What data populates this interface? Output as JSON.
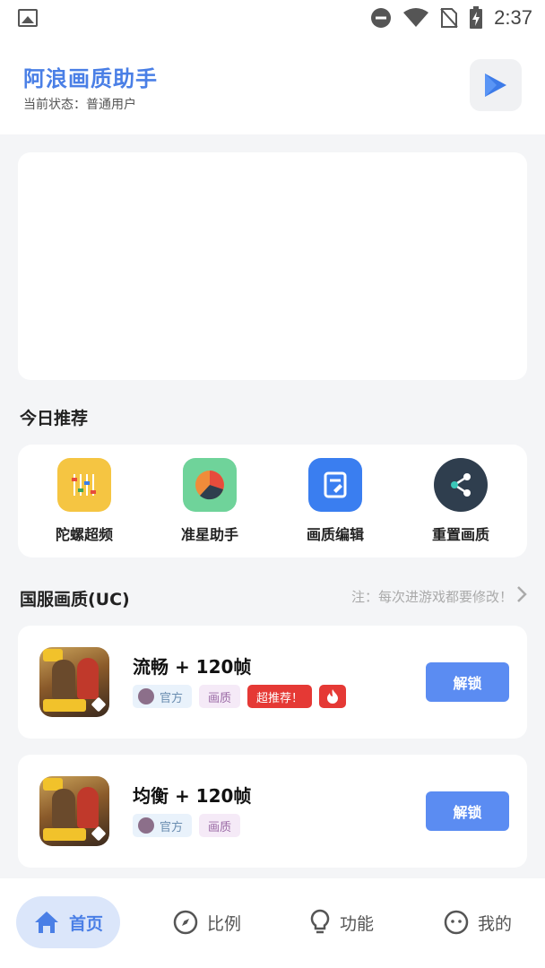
{
  "status_bar": {
    "time": "2:37"
  },
  "header": {
    "title": "阿浪画质助手",
    "status": "当前状态：普通用户"
  },
  "recommend": {
    "title": "今日推荐",
    "items": [
      {
        "label": "陀螺超频",
        "icon": "equalizer-icon",
        "color": "#f5c542"
      },
      {
        "label": "准星助手",
        "icon": "pie-chart-icon",
        "color": "#6fd39a"
      },
      {
        "label": "画质编辑",
        "icon": "edit-document-icon",
        "color": "#3a7ef0"
      },
      {
        "label": "重置画质",
        "icon": "share-icon",
        "color": "#2f3e4e"
      }
    ]
  },
  "server_section": {
    "title": "国服画质(UC)",
    "note": "注：每次进游戏都要修改！"
  },
  "games": [
    {
      "name": "流畅 + 120帧",
      "tags": [
        "官方",
        "画质",
        "超推荐！"
      ],
      "hot": true,
      "button": "解锁"
    },
    {
      "name": "均衡 + 120帧",
      "tags": [
        "官方",
        "画质"
      ],
      "hot": false,
      "button": "解锁"
    }
  ],
  "nav": {
    "items": [
      {
        "label": "首页",
        "icon": "home-icon",
        "active": true
      },
      {
        "label": "比例",
        "icon": "compass-icon",
        "active": false
      },
      {
        "label": "功能",
        "icon": "lightbulb-icon",
        "active": false
      },
      {
        "label": "我的",
        "icon": "user-face-icon",
        "active": false
      }
    ]
  },
  "colors": {
    "accent": "#4a7fe6",
    "button": "#5b8cf2",
    "hot": "#e53935"
  }
}
